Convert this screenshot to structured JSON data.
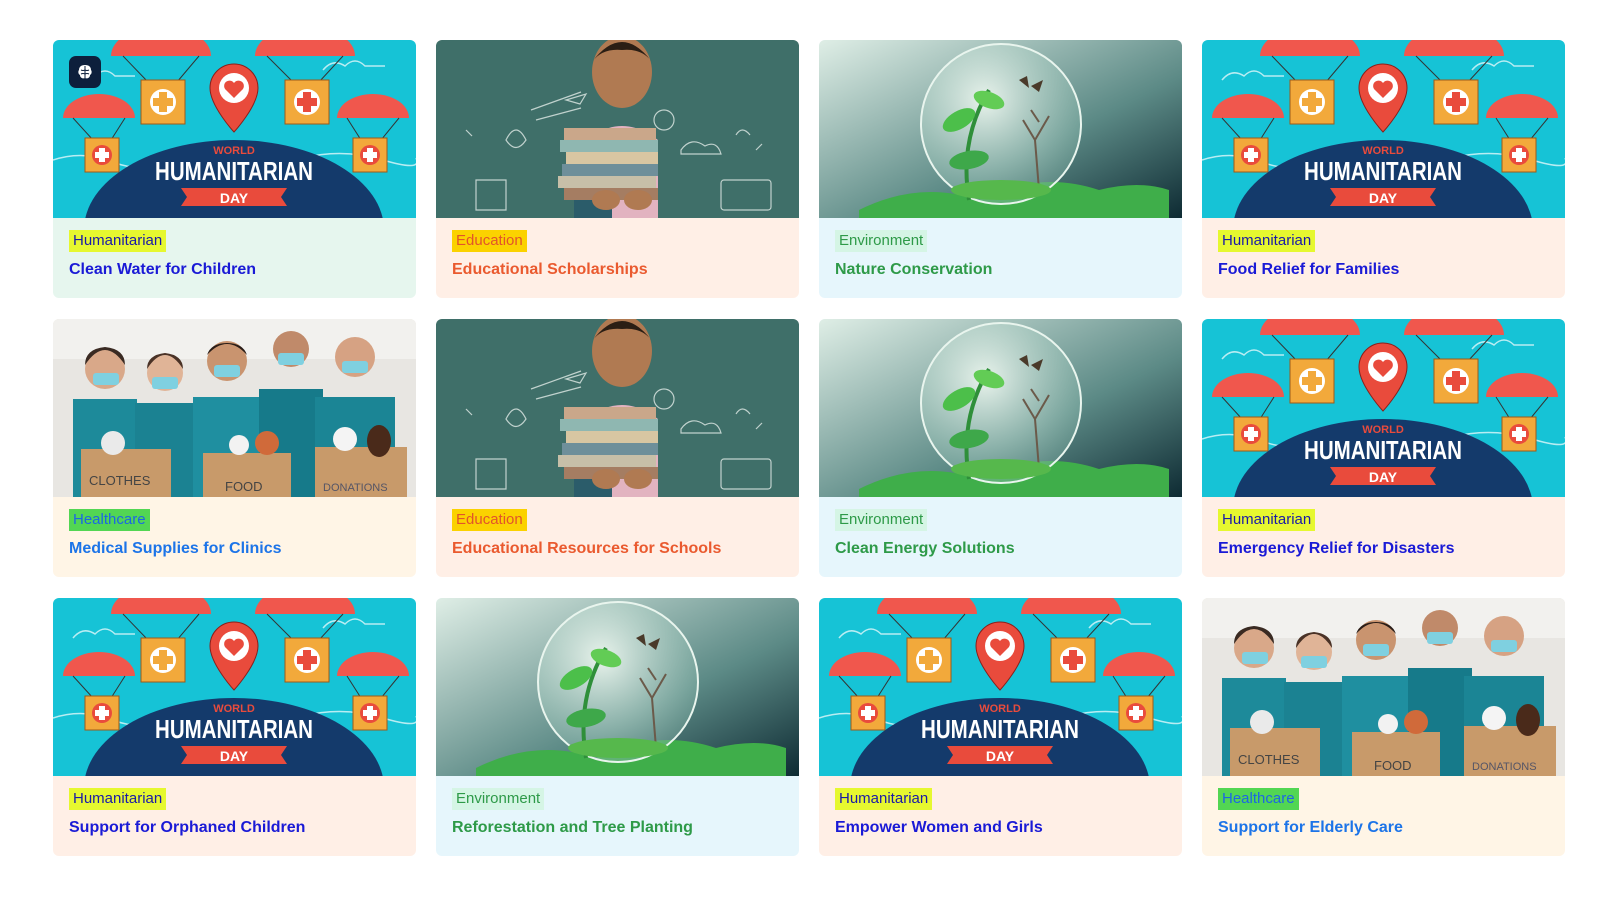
{
  "cards": [
    {
      "category": "Humanitarian",
      "title": "Clean Water for Children",
      "image": "world-humanitarian-day",
      "bg": "#e6f6ee"
    },
    {
      "category": "Education",
      "title": "Educational Scholarships",
      "image": "boy-with-books",
      "bg": "#ffefe6"
    },
    {
      "category": "Environment",
      "title": "Nature Conservation",
      "image": "glass-globe-plant",
      "bg": "#e6f6fc"
    },
    {
      "category": "Humanitarian",
      "title": "Food Relief for Families",
      "image": "world-humanitarian-day",
      "bg": "#ffefe6"
    },
    {
      "category": "Healthcare",
      "title": "Medical Supplies for Clinics",
      "image": "volunteers-donations",
      "bg": "#fff5e6"
    },
    {
      "category": "Education",
      "title": "Educational Resources for Schools",
      "image": "boy-with-books",
      "bg": "#ffefe6"
    },
    {
      "category": "Environment",
      "title": "Clean Energy Solutions",
      "image": "glass-globe-plant",
      "bg": "#e6f6fc"
    },
    {
      "category": "Humanitarian",
      "title": "Emergency Relief for Disasters",
      "image": "world-humanitarian-day",
      "bg": "#ffefe6"
    },
    {
      "category": "Humanitarian",
      "title": "Support for Orphaned Children",
      "image": "world-humanitarian-day",
      "bg": "#ffefe6"
    },
    {
      "category": "Environment",
      "title": "Reforestation and Tree Planting",
      "image": "glass-globe-plant",
      "bg": "#e6f6fc"
    },
    {
      "category": "Humanitarian",
      "title": "Empower Women and Girls",
      "image": "world-humanitarian-day",
      "bg": "#ffefe6"
    },
    {
      "category": "Healthcare",
      "title": "Support for Elderly Care",
      "image": "volunteers-donations",
      "bg": "#fff5e6"
    }
  ],
  "image_text": {
    "humanitarian_world": "WORLD",
    "humanitarian_main": "HUMANITARIAN",
    "humanitarian_day": "DAY",
    "volunteer_box_1": "CLOTHES",
    "volunteer_box_2": "FOOD",
    "volunteer_box_3": "DONATIONS"
  },
  "badge_icon": "brain-icon",
  "colors": {
    "humanitarian_tag_bg": "#e6f82f",
    "education_tag_bg": "#fbd200",
    "environment_tag_bg": "#d5f5e5",
    "healthcare_tag_bg": "#52d653"
  }
}
